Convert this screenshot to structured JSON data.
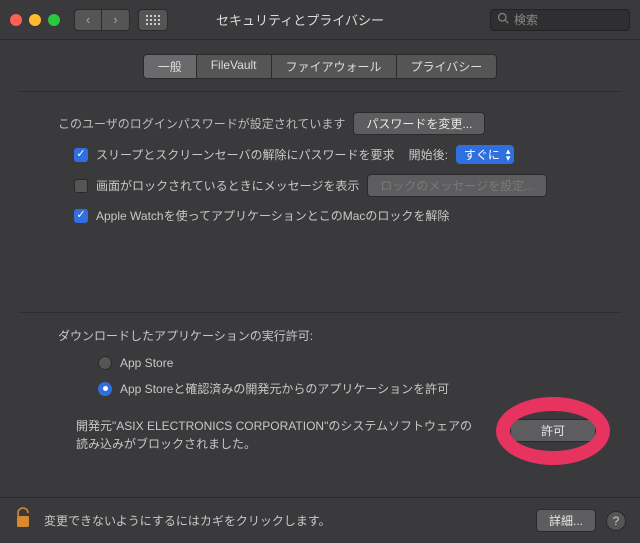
{
  "window": {
    "title": "セキュリティとプライバシー",
    "search_placeholder": "検索"
  },
  "tabs": {
    "general": "一般",
    "filevault": "FileVault",
    "firewall": "ファイアウォール",
    "privacy": "プライバシー"
  },
  "general": {
    "login_password_set": "このユーザのログインパスワードが設定されています",
    "change_password_btn": "パスワードを変更...",
    "require_password_label": "スリープとスクリーンセーバの解除にパスワードを要求",
    "after_label": "開始後:",
    "after_value": "すぐに",
    "lock_message_label": "画面がロックされているときにメッセージを表示",
    "set_lock_message_btn": "ロックのメッセージを設定...",
    "apple_watch_label": "Apple Watchを使ってアプリケーションとこのMacのロックを解除"
  },
  "downloads": {
    "heading": "ダウンロードしたアプリケーションの実行許可:",
    "appstore": "App Store",
    "appstore_dev": "App Storeと確認済みの開発元からのアプリケーションを許可"
  },
  "blocked": {
    "text": "開発元\"ASIX ELECTRONICS CORPORATION\"のシステムソフトウェアの読み込みがブロックされました。",
    "allow_btn": "許可"
  },
  "footer": {
    "lock_hint": "変更できないようにするにはカギをクリックします。",
    "advanced_btn": "詳細..."
  }
}
